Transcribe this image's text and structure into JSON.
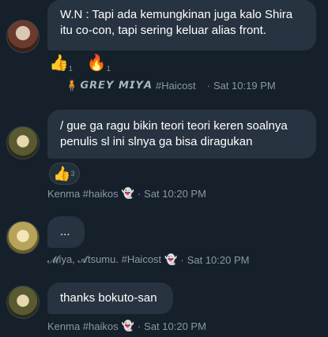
{
  "messages": [
    {
      "text_lines": [
        "W.N : Tapi ada kemungkinan juga kalo Shira",
        "itu co-con, tapi sering keluar alias front."
      ],
      "reactions": [
        {
          "emoji": "👍",
          "count": "1"
        },
        {
          "emoji": "🔥",
          "count": "1"
        }
      ],
      "sender_prefix_icon": "person-icon",
      "sender": "𝙂𝙍𝙀𝙔 𝙈𝙄𝙔𝘼",
      "sender_tag": "#Haicost",
      "time": "Sat 10:19 PM"
    },
    {
      "text_lines": [
        "/ gue ga ragu bikin teori teori keren soalnya",
        "penulis sl ini slnya ga bisa diragukan"
      ],
      "reactions": [
        {
          "emoji": "👍",
          "count": "3"
        }
      ],
      "sender": "Kenma #haikos",
      "sender_icon": "ghost-icon",
      "time": "Sat 10:20 PM"
    },
    {
      "text_lines": [
        "..."
      ],
      "sender": "𝓜iya, 𝓐tsumu. #Haicost",
      "sender_icon": "ghost-icon",
      "time": "Sat 10:20 PM"
    },
    {
      "text_lines": [
        "thanks bokuto-san"
      ],
      "sender": "Kenma #haikos",
      "sender_icon": "ghost-icon",
      "time": "Sat 10:20 PM"
    }
  ],
  "icons": {
    "ghost": "👻",
    "person": "🧍",
    "separator": "·"
  }
}
